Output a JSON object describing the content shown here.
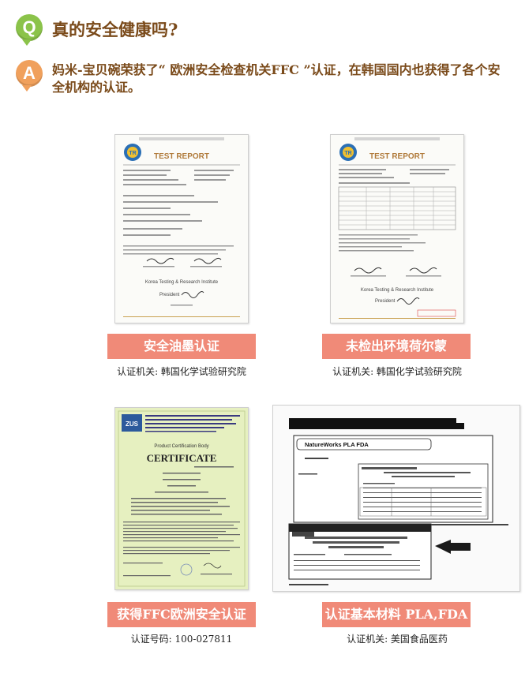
{
  "question": {
    "icon": "Q",
    "text": "真的安全健康吗?"
  },
  "answer": {
    "icon": "A",
    "text": "妈米-宝贝碗荣获了“ 欧洲安全检查机关FFC ”认证，在韩国国内也获得了各个安全机构的认证。"
  },
  "certificates": [
    {
      "label": "安全油墨认证",
      "caption": "认证机关: 韩国化学试验研究院",
      "doc": {
        "header": "TEST REPORT",
        "institute": "Korea Testing & Research Institute",
        "role": "President"
      }
    },
    {
      "label": "未检出环境荷尔蒙",
      "caption": "认证机关: 韩国化学试验研究院",
      "doc": {
        "header": "TEST REPORT",
        "institute": "Korea Testing & Research Institute",
        "role": "President"
      }
    },
    {
      "label": "获得FFC欧洲安全认证",
      "caption": "认证号码: 100-027811",
      "doc": {
        "header": "CERTIFICATE",
        "subheader": "Product Certification Body",
        "logo": "ZUS"
      }
    },
    {
      "label": "认证基本材料 PLA,FDA",
      "caption": "认证机关: 美国食品医药",
      "doc": {
        "banner": "NatureWorks PLA FDA"
      }
    }
  ],
  "colors": {
    "q_badge": "#8bc34a",
    "a_badge": "#f0a05c",
    "heading_text": "#7a4a1a",
    "label_bg": "#f08a78"
  }
}
